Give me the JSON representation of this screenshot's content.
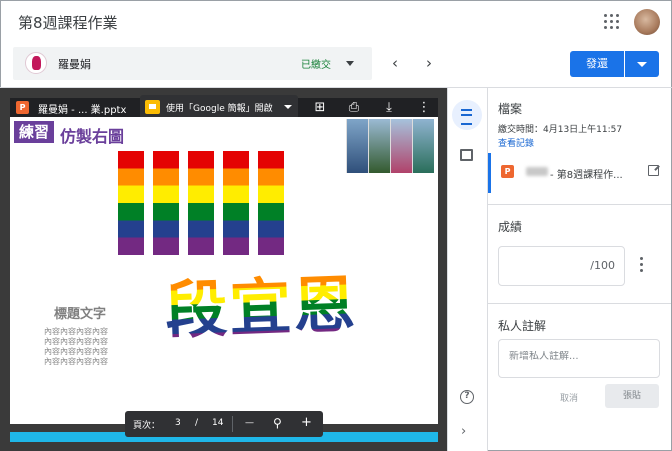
{
  "header": {
    "title": "第8週課程作業"
  },
  "student_bar": {
    "name": "羅曼娟",
    "status": "已繳交",
    "status_color": "#188038"
  },
  "navigation": {
    "prev_icon": "‹",
    "next_icon": "›"
  },
  "actions": {
    "return_label": "發還",
    "accent_color": "#1a73e8"
  },
  "viewer": {
    "file_badge": "P",
    "file_title": "羅曼娟 - ... 業.pptx",
    "open_with_label": "使用「Google 簡報」開啟",
    "slide": {
      "badge": "練習",
      "heading": "仿製右圖",
      "big_name": "段宜恩",
      "sample_title": "標題文字",
      "sample_lines": [
        "內容內容內容內容",
        "內容內容內容內容",
        "內容內容內容內容",
        "內容內容內容內容"
      ]
    },
    "pagebar": {
      "page_label": "頁次：",
      "current": "3",
      "separator": "/",
      "total": "14",
      "zoom_out": "—",
      "zoom_in": "+"
    }
  },
  "panel": {
    "files_title": "檔案",
    "submit_time": "繳交時間：4月13日上午11:57",
    "history_link": "查看記錄",
    "file_badge": "P",
    "file_name": "- 第8週課程作...",
    "grade_title": "成績",
    "grade_denominator": "/100",
    "notes_title": "私人註解",
    "notes_placeholder": "新增私人註解...",
    "cancel_label": "取消",
    "post_label": "張貼"
  }
}
